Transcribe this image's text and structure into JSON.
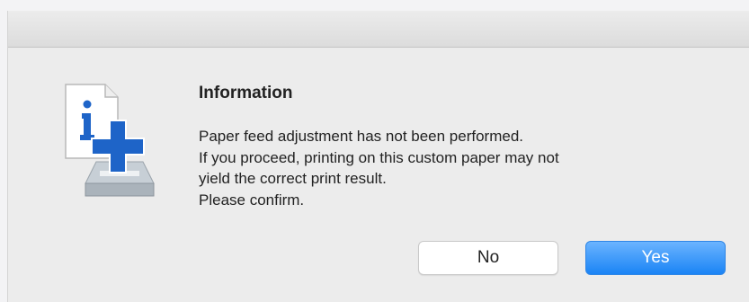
{
  "dialog": {
    "title": "Information",
    "message_lines": [
      "Paper feed adjustment has not been performed.",
      "If you proceed, printing on this custom paper may not",
      "yield the correct print result.",
      "Please confirm."
    ],
    "icon": "info-add-paper-icon",
    "buttons": {
      "no": "No",
      "yes": "Yes"
    }
  },
  "colors": {
    "accent": "#1a84f5",
    "plus": "#1e64c8"
  }
}
